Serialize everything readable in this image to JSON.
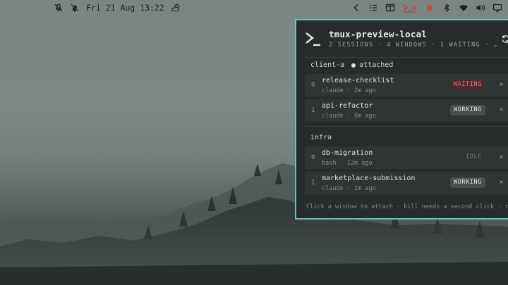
{
  "topbar": {
    "left": {
      "icons": [
        "mic-muted-icon",
        "bell-muted-icon"
      ],
      "datetime": "Fri 21 Aug 13:22",
      "weather_icon": "partly-cloudy-icon"
    },
    "right_icons": [
      "chevron-left-icon",
      "list-icon",
      "columns-icon",
      "terminal-icon",
      "notification-dot-icon",
      "bluetooth-icon",
      "wifi-icon",
      "volume-icon",
      "display-icon"
    ]
  },
  "panel": {
    "title": "tmux-preview-local",
    "subtitle": "2 SESSIONS · 4 WINDOWS · 1 WAITING · …",
    "sessions": [
      {
        "name": "client-a",
        "status": "attached",
        "windows": [
          {
            "index": "0",
            "name": "release-checklist",
            "meta": "claude · 2m ago",
            "badge": "WAITING"
          },
          {
            "index": "1",
            "name": "api-refactor",
            "meta": "claude · 6m ago",
            "badge": "WORKING"
          }
        ]
      },
      {
        "name": "infra",
        "windows": [
          {
            "index": "0",
            "name": "db-migration",
            "meta": "bash · 12m ago",
            "badge": "IDLE"
          },
          {
            "index": "1",
            "name": "marketplace-submission",
            "meta": "claude · 1m ago",
            "badge": "WORKING"
          }
        ]
      }
    ],
    "footer": "Click a window to attach · kill needs a second click · r"
  },
  "colors": {
    "panel_border": "#6bc2b6",
    "panel_bg": "#262b2b",
    "waiting": "#e0727a",
    "active_tray": "#c33b3b"
  }
}
